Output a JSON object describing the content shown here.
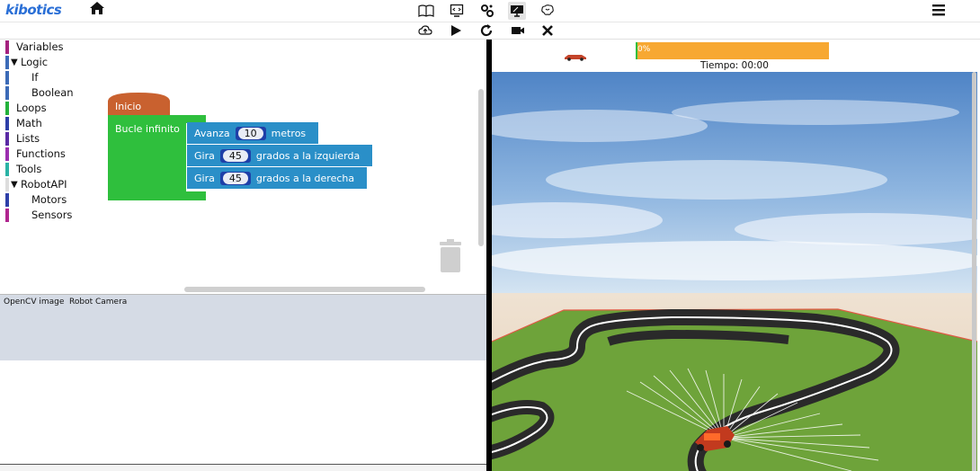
{
  "app": {
    "logo_text": "kibotics"
  },
  "topbar": {
    "icons": [
      "home-icon",
      "book-icon",
      "code-monitor-icon",
      "gears-icon",
      "monitor-icon",
      "brain-icon",
      "hamburger-menu-icon"
    ]
  },
  "toolbar": {
    "icons": [
      "upload-cloud-icon",
      "play-icon",
      "reset-icon",
      "camera-icon",
      "close-icon"
    ]
  },
  "toolbox": {
    "items": [
      {
        "label": "Variables",
        "color": "#a5227f",
        "indent": 0,
        "arrow": ""
      },
      {
        "label": "Logic",
        "color": "#3c6bb7",
        "indent": 0,
        "arrow": "▼"
      },
      {
        "label": "If",
        "color": "#3c6bb7",
        "indent": 1,
        "arrow": ""
      },
      {
        "label": "Boolean",
        "color": "#3c6bb7",
        "indent": 1,
        "arrow": ""
      },
      {
        "label": "Loops",
        "color": "#23b23b",
        "indent": 0,
        "arrow": ""
      },
      {
        "label": "Math",
        "color": "#2e3fa8",
        "indent": 0,
        "arrow": ""
      },
      {
        "label": "Lists",
        "color": "#5a2aa5",
        "indent": 0,
        "arrow": ""
      },
      {
        "label": "Functions",
        "color": "#9c2fb0",
        "indent": 0,
        "arrow": ""
      },
      {
        "label": "Tools",
        "color": "#2ab3a5",
        "indent": 0,
        "arrow": ""
      },
      {
        "label": "RobotAPI",
        "color": "#dddddd",
        "indent": 0,
        "arrow": "▼"
      },
      {
        "label": "Motors",
        "color": "#2e3fa8",
        "indent": 1,
        "arrow": ""
      },
      {
        "label": "Sensors",
        "color": "#b0268f",
        "indent": 1,
        "arrow": ""
      }
    ]
  },
  "blocks": {
    "start": "Inicio",
    "loop": "Bucle infinito",
    "forward": {
      "verb": "Avanza",
      "value": "10",
      "unit": "metros"
    },
    "turn_left": {
      "verb": "Gira",
      "value": "45",
      "unit": "grados a la izquierda"
    },
    "turn_right": {
      "verb": "Gira",
      "value": "45",
      "unit": "grados a la derecha"
    },
    "colors": {
      "start": "#c9612f",
      "loop": "#2fbf3d",
      "motion": "#2a8fc8"
    }
  },
  "camera_tabs": [
    "OpenCV image",
    "Robot Camera"
  ],
  "sim": {
    "progress_text": "0%",
    "progress_value": 0,
    "progress_color": "#f7a832",
    "timer": "Tiempo: 00:00"
  }
}
